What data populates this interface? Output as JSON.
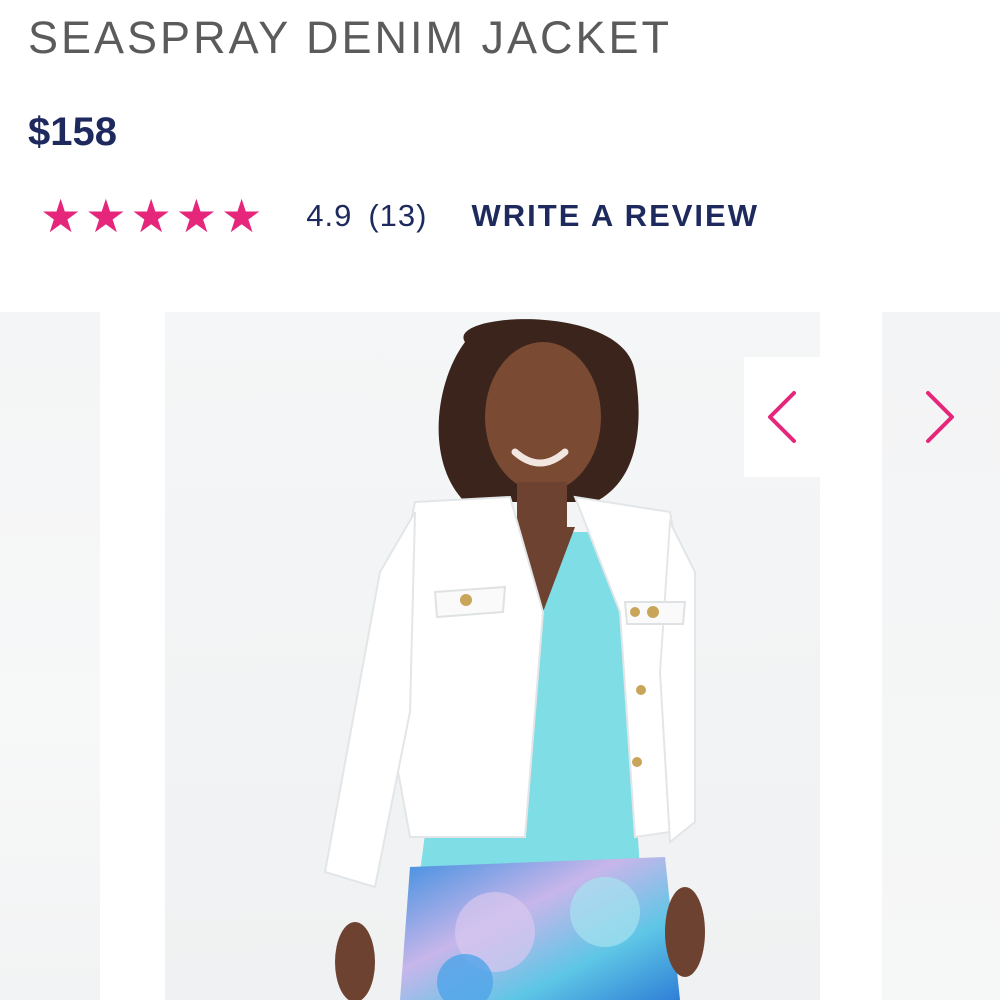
{
  "product": {
    "title": "SEASPRAY DENIM JACKET",
    "price": "$158"
  },
  "rating": {
    "stars": 5,
    "star_glyph": "★",
    "value": "4.9",
    "count": "(13)",
    "write_review_label": "WRITE A REVIEW"
  },
  "gallery": {
    "prev_icon": "chevron-left-icon",
    "next_icon": "chevron-right-icon"
  },
  "colors": {
    "accent_pink": "#e5267b",
    "navy": "#1e2a5e",
    "title_gray": "#5b5b5b",
    "jacket_white": "#ffffff",
    "top_aqua": "#7fdde6"
  }
}
